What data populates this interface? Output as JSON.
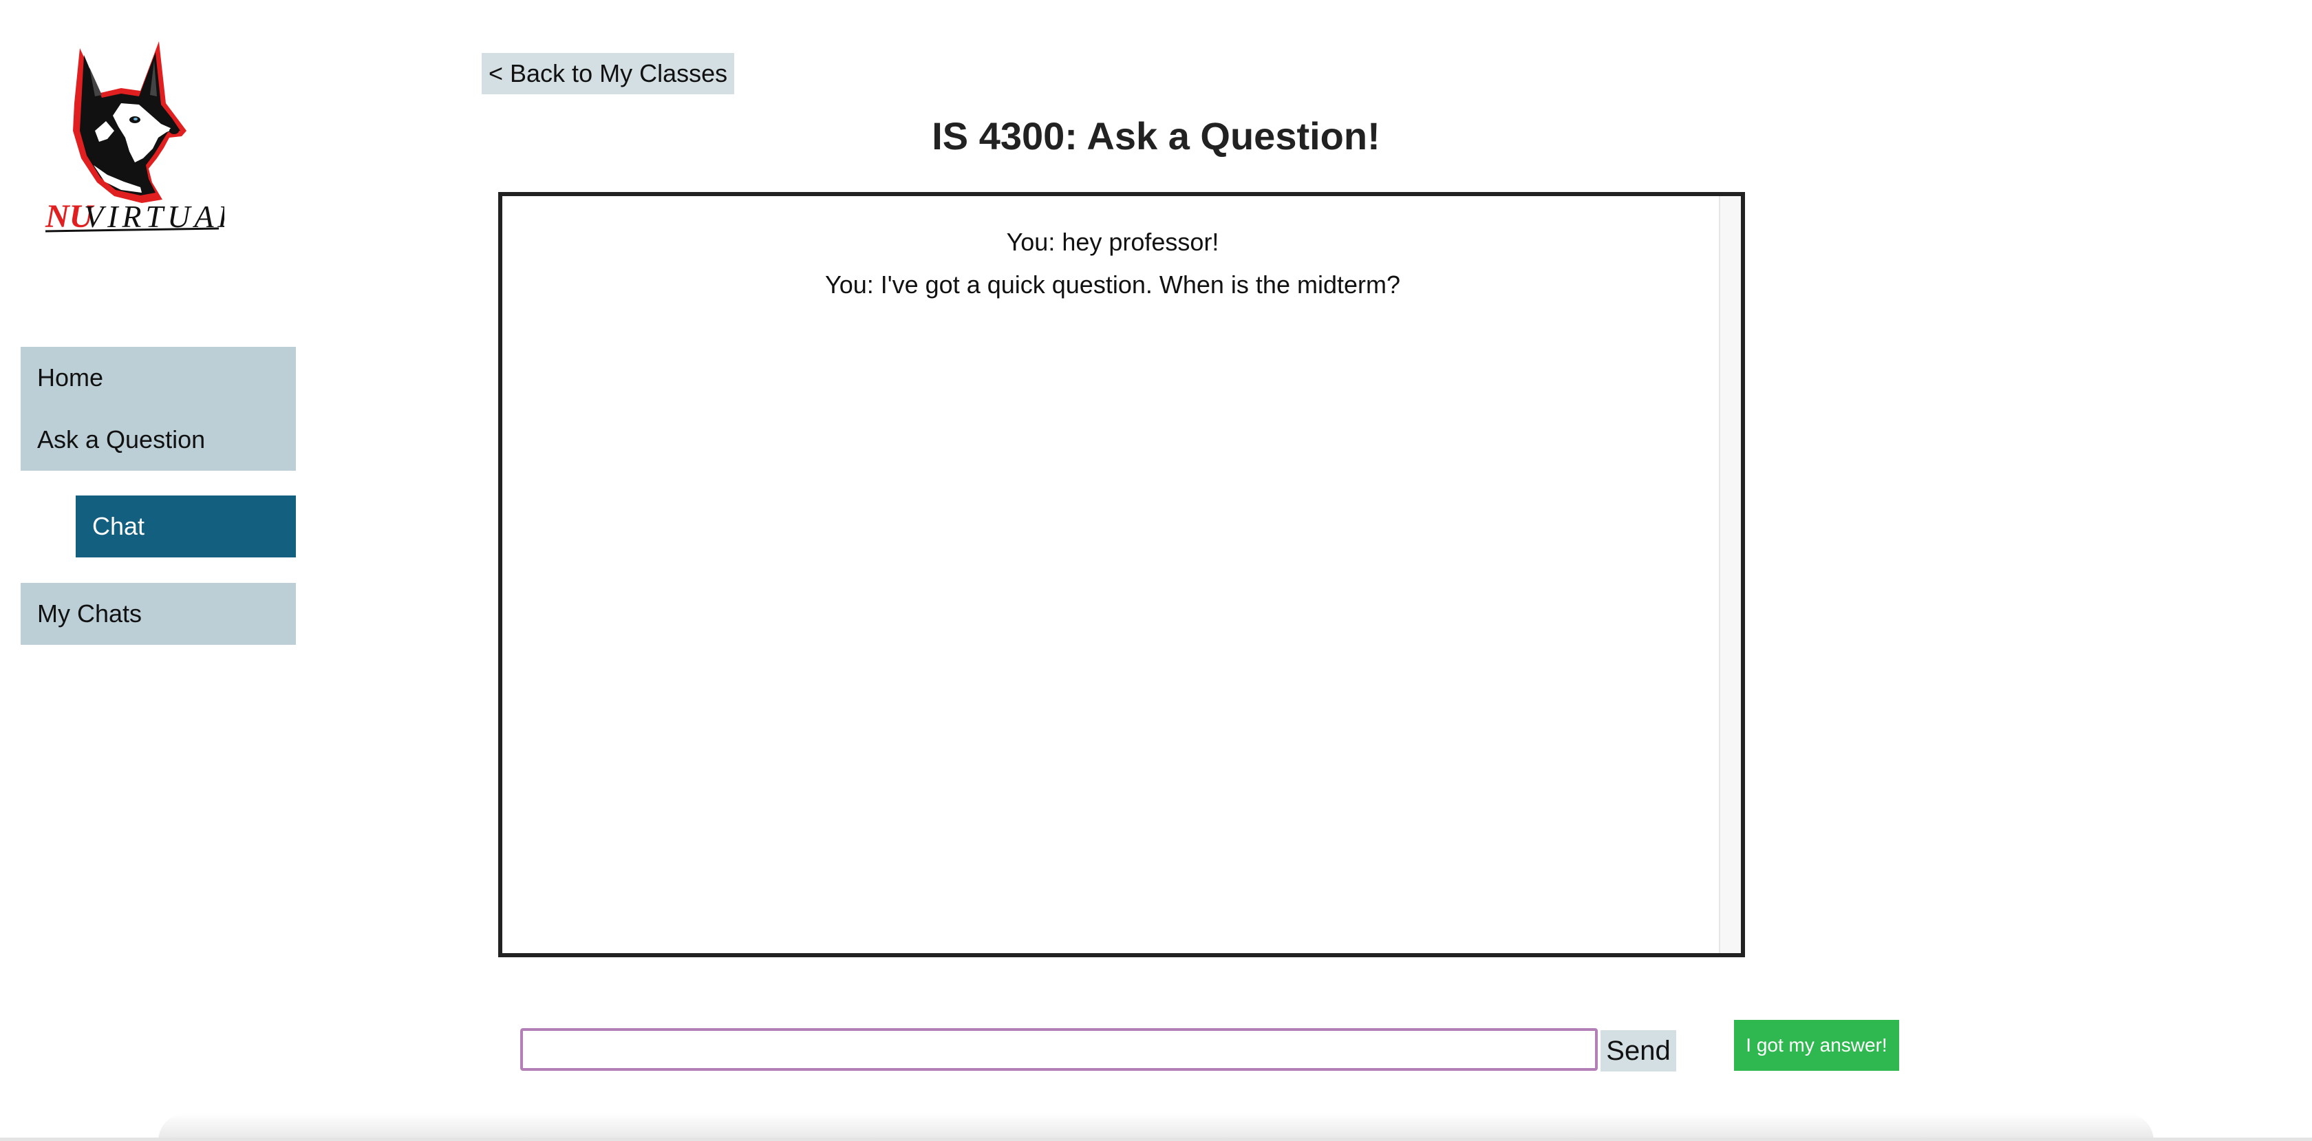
{
  "brand": {
    "logo_icon": "husky-logo-icon",
    "wordmark_red": "NU",
    "wordmark_black": "VIRTUAL",
    "accent_red": "#e02020"
  },
  "sidebar": {
    "items": [
      {
        "label": "Home",
        "active": false
      },
      {
        "label": "Ask a Question",
        "active": false
      },
      {
        "label": "Chat",
        "active": true
      },
      {
        "label": "My Chats",
        "active": false
      }
    ],
    "bg_color": "#bccfd6",
    "active_color": "#135f7f"
  },
  "header": {
    "back_label": "< Back to My Classes",
    "title": "IS 4300: Ask a Question!"
  },
  "chat": {
    "messages": [
      "You: hey professor!",
      "You: I've got a quick question. When is the midterm?"
    ]
  },
  "composer": {
    "input_value": "",
    "input_placeholder": "",
    "send_label": "Send",
    "answer_label": "I got my answer!",
    "answer_color": "#2fb84f"
  }
}
